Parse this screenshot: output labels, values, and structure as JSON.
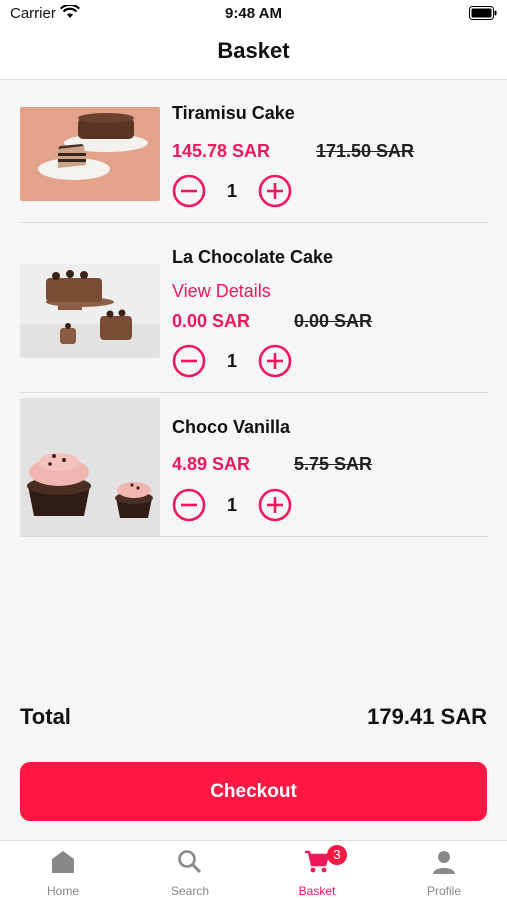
{
  "status": {
    "carrier": "Carrier",
    "time": "9:48 AM"
  },
  "header": {
    "title": "Basket"
  },
  "items": [
    {
      "name": "Tiramisu Cake",
      "price": "145.78 SAR",
      "old_price": "171.50 SAR",
      "quantity": "1"
    },
    {
      "name": "La Chocolate Cake",
      "details_link": "View Details",
      "price": "0.00 SAR",
      "old_price": "0.00 SAR",
      "quantity": "1"
    },
    {
      "name": "Choco Vanilla",
      "price": "4.89 SAR",
      "old_price": "5.75 SAR",
      "quantity": "1"
    }
  ],
  "summary": {
    "total_label": "Total",
    "total_value": "179.41 SAR"
  },
  "checkout": {
    "label": "Checkout"
  },
  "tabs": [
    {
      "label": "Home",
      "icon": "home-icon"
    },
    {
      "label": "Search",
      "icon": "search-icon"
    },
    {
      "label": "Basket",
      "icon": "cart-icon",
      "badge": "3",
      "active": true
    },
    {
      "label": "Profile",
      "icon": "person-icon"
    }
  ],
  "colors": {
    "accent": "#f0185a",
    "button": "#ff1744",
    "tab_inactive": "#888888"
  }
}
